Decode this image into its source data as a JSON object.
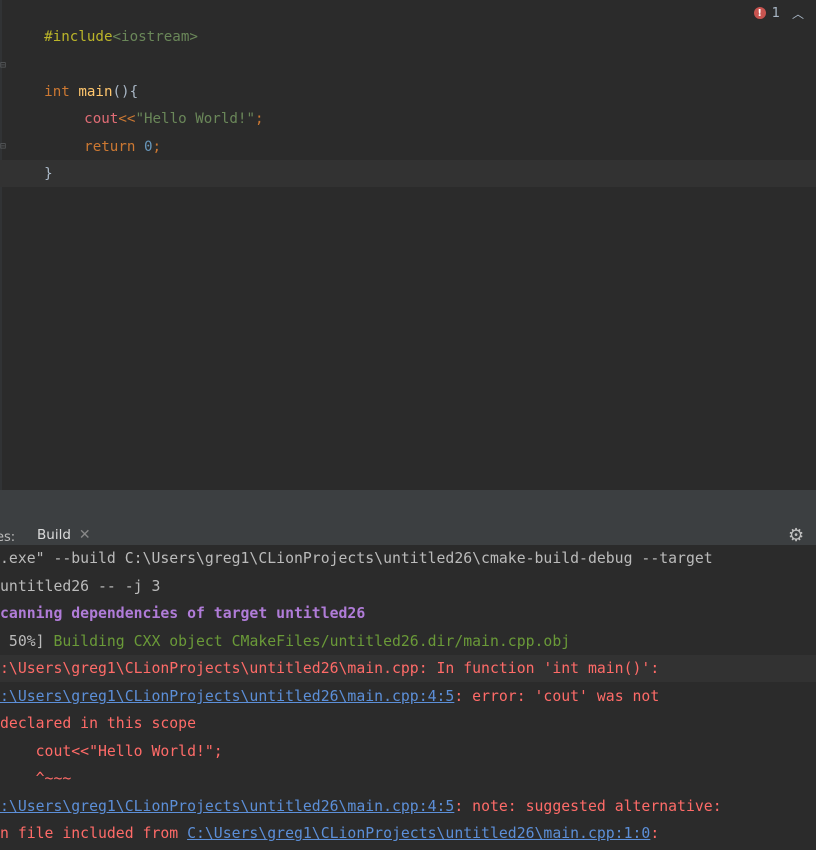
{
  "editor": {
    "lines": [
      {
        "pp": "#include",
        "inc": "<iostream>"
      },
      {},
      {
        "kw": "int",
        "fn": "main",
        "rest": "(){"
      },
      {
        "ident": "cout",
        "op": "<<",
        "str": "\"Hello World!\"",
        "semi": ";"
      },
      {
        "kw": "return",
        "num": "0",
        "semi": ";"
      },
      {
        "rest": "}"
      }
    ],
    "error_count": "1",
    "error_icon": "error-icon",
    "nav_icon": "chevron-up-icon"
  },
  "toolwindow": {
    "prev_tab_label": "es:",
    "build_tab_label": "Build",
    "close_icon": "close-icon",
    "settings_icon": "gear-icon"
  },
  "console": {
    "line1": ".exe\" --build C:\\Users\\greg1\\CLionProjects\\untitled26\\cmake-build-debug --target",
    "line2": "untitled26 -- -j 3",
    "line3": "canning dependencies of target untitled26",
    "line4_pct": " 50%] ",
    "line4_msg": "Building CXX object CMakeFiles/untitled26.dir/main.cpp.obj",
    "line5": ":\\Users\\greg1\\CLionProjects\\untitled26\\main.cpp: In function 'int main()':",
    "line6_link": ":\\Users\\greg1\\CLionProjects\\untitled26\\main.cpp:4:5",
    "line6_msg": ": error: 'cout' was not",
    "line7": "declared in this scope",
    "line8": "    cout<<\"Hello World!\";",
    "line9": "    ^~~~",
    "line10_link": ":\\Users\\greg1\\CLionProjects\\untitled26\\main.cpp:4:5",
    "line10_msg": ": note: suggested alternative:",
    "line11_prefix": "n file included from ",
    "line11_link": "C:\\Users\\greg1\\CLionProjects\\untitled26\\main.cpp:1:0",
    "line11_suffix": ":"
  },
  "colors": {
    "background": "#2b2b2b",
    "keyword": "#cc7832",
    "string": "#6a8759",
    "error": "#ff6b68",
    "link": "#5c8fd8",
    "accent": "#4a88c7"
  }
}
